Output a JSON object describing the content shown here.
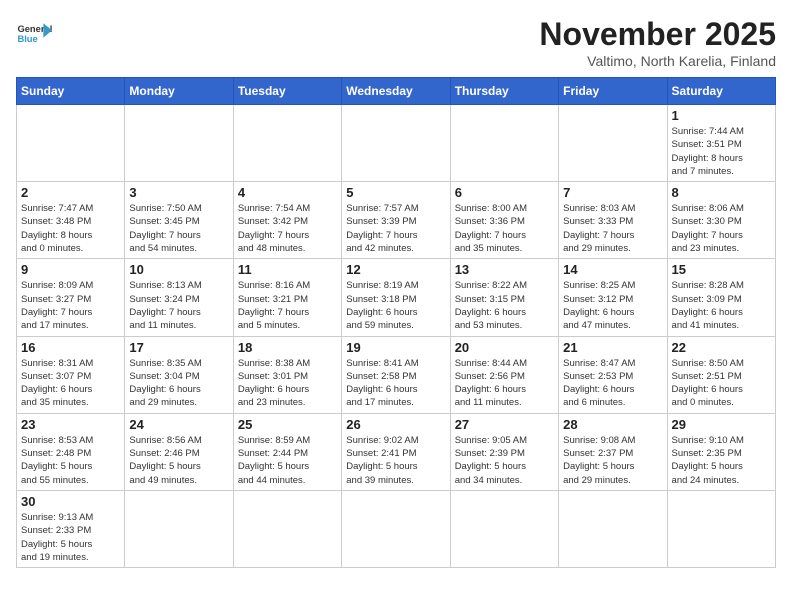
{
  "header": {
    "logo_general": "General",
    "logo_blue": "Blue",
    "title": "November 2025",
    "subtitle": "Valtimo, North Karelia, Finland"
  },
  "weekdays": [
    "Sunday",
    "Monday",
    "Tuesday",
    "Wednesday",
    "Thursday",
    "Friday",
    "Saturday"
  ],
  "weeks": [
    [
      {
        "day": "",
        "info": ""
      },
      {
        "day": "",
        "info": ""
      },
      {
        "day": "",
        "info": ""
      },
      {
        "day": "",
        "info": ""
      },
      {
        "day": "",
        "info": ""
      },
      {
        "day": "",
        "info": ""
      },
      {
        "day": "1",
        "info": "Sunrise: 7:44 AM\nSunset: 3:51 PM\nDaylight: 8 hours\nand 7 minutes."
      }
    ],
    [
      {
        "day": "2",
        "info": "Sunrise: 7:47 AM\nSunset: 3:48 PM\nDaylight: 8 hours\nand 0 minutes."
      },
      {
        "day": "3",
        "info": "Sunrise: 7:50 AM\nSunset: 3:45 PM\nDaylight: 7 hours\nand 54 minutes."
      },
      {
        "day": "4",
        "info": "Sunrise: 7:54 AM\nSunset: 3:42 PM\nDaylight: 7 hours\nand 48 minutes."
      },
      {
        "day": "5",
        "info": "Sunrise: 7:57 AM\nSunset: 3:39 PM\nDaylight: 7 hours\nand 42 minutes."
      },
      {
        "day": "6",
        "info": "Sunrise: 8:00 AM\nSunset: 3:36 PM\nDaylight: 7 hours\nand 35 minutes."
      },
      {
        "day": "7",
        "info": "Sunrise: 8:03 AM\nSunset: 3:33 PM\nDaylight: 7 hours\nand 29 minutes."
      },
      {
        "day": "8",
        "info": "Sunrise: 8:06 AM\nSunset: 3:30 PM\nDaylight: 7 hours\nand 23 minutes."
      }
    ],
    [
      {
        "day": "9",
        "info": "Sunrise: 8:09 AM\nSunset: 3:27 PM\nDaylight: 7 hours\nand 17 minutes."
      },
      {
        "day": "10",
        "info": "Sunrise: 8:13 AM\nSunset: 3:24 PM\nDaylight: 7 hours\nand 11 minutes."
      },
      {
        "day": "11",
        "info": "Sunrise: 8:16 AM\nSunset: 3:21 PM\nDaylight: 7 hours\nand 5 minutes."
      },
      {
        "day": "12",
        "info": "Sunrise: 8:19 AM\nSunset: 3:18 PM\nDaylight: 6 hours\nand 59 minutes."
      },
      {
        "day": "13",
        "info": "Sunrise: 8:22 AM\nSunset: 3:15 PM\nDaylight: 6 hours\nand 53 minutes."
      },
      {
        "day": "14",
        "info": "Sunrise: 8:25 AM\nSunset: 3:12 PM\nDaylight: 6 hours\nand 47 minutes."
      },
      {
        "day": "15",
        "info": "Sunrise: 8:28 AM\nSunset: 3:09 PM\nDaylight: 6 hours\nand 41 minutes."
      }
    ],
    [
      {
        "day": "16",
        "info": "Sunrise: 8:31 AM\nSunset: 3:07 PM\nDaylight: 6 hours\nand 35 minutes."
      },
      {
        "day": "17",
        "info": "Sunrise: 8:35 AM\nSunset: 3:04 PM\nDaylight: 6 hours\nand 29 minutes."
      },
      {
        "day": "18",
        "info": "Sunrise: 8:38 AM\nSunset: 3:01 PM\nDaylight: 6 hours\nand 23 minutes."
      },
      {
        "day": "19",
        "info": "Sunrise: 8:41 AM\nSunset: 2:58 PM\nDaylight: 6 hours\nand 17 minutes."
      },
      {
        "day": "20",
        "info": "Sunrise: 8:44 AM\nSunset: 2:56 PM\nDaylight: 6 hours\nand 11 minutes."
      },
      {
        "day": "21",
        "info": "Sunrise: 8:47 AM\nSunset: 2:53 PM\nDaylight: 6 hours\nand 6 minutes."
      },
      {
        "day": "22",
        "info": "Sunrise: 8:50 AM\nSunset: 2:51 PM\nDaylight: 6 hours\nand 0 minutes."
      }
    ],
    [
      {
        "day": "23",
        "info": "Sunrise: 8:53 AM\nSunset: 2:48 PM\nDaylight: 5 hours\nand 55 minutes."
      },
      {
        "day": "24",
        "info": "Sunrise: 8:56 AM\nSunset: 2:46 PM\nDaylight: 5 hours\nand 49 minutes."
      },
      {
        "day": "25",
        "info": "Sunrise: 8:59 AM\nSunset: 2:44 PM\nDaylight: 5 hours\nand 44 minutes."
      },
      {
        "day": "26",
        "info": "Sunrise: 9:02 AM\nSunset: 2:41 PM\nDaylight: 5 hours\nand 39 minutes."
      },
      {
        "day": "27",
        "info": "Sunrise: 9:05 AM\nSunset: 2:39 PM\nDaylight: 5 hours\nand 34 minutes."
      },
      {
        "day": "28",
        "info": "Sunrise: 9:08 AM\nSunset: 2:37 PM\nDaylight: 5 hours\nand 29 minutes."
      },
      {
        "day": "29",
        "info": "Sunrise: 9:10 AM\nSunset: 2:35 PM\nDaylight: 5 hours\nand 24 minutes."
      }
    ],
    [
      {
        "day": "30",
        "info": "Sunrise: 9:13 AM\nSunset: 2:33 PM\nDaylight: 5 hours\nand 19 minutes."
      },
      {
        "day": "",
        "info": ""
      },
      {
        "day": "",
        "info": ""
      },
      {
        "day": "",
        "info": ""
      },
      {
        "day": "",
        "info": ""
      },
      {
        "day": "",
        "info": ""
      },
      {
        "day": "",
        "info": ""
      }
    ]
  ]
}
